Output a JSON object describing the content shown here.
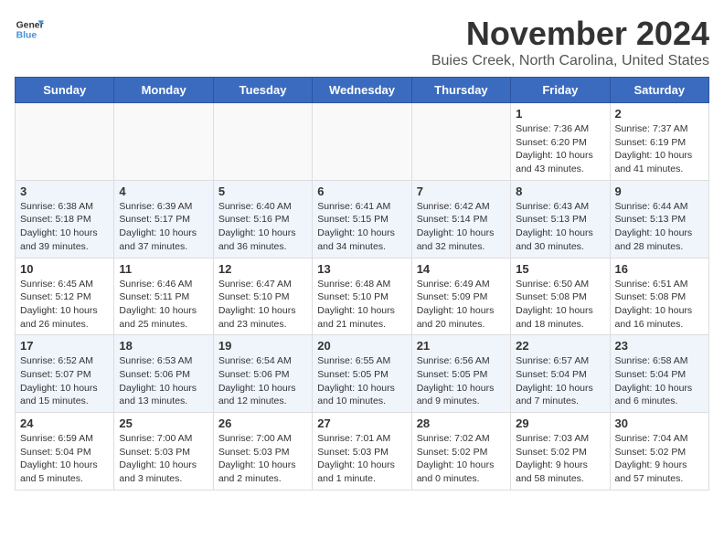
{
  "header": {
    "logo_general": "General",
    "logo_blue": "Blue",
    "month_title": "November 2024",
    "location": "Buies Creek, North Carolina, United States"
  },
  "weekdays": [
    "Sunday",
    "Monday",
    "Tuesday",
    "Wednesday",
    "Thursday",
    "Friday",
    "Saturday"
  ],
  "weeks": [
    [
      {
        "day": "",
        "info": ""
      },
      {
        "day": "",
        "info": ""
      },
      {
        "day": "",
        "info": ""
      },
      {
        "day": "",
        "info": ""
      },
      {
        "day": "",
        "info": ""
      },
      {
        "day": "1",
        "info": "Sunrise: 7:36 AM\nSunset: 6:20 PM\nDaylight: 10 hours and 43 minutes."
      },
      {
        "day": "2",
        "info": "Sunrise: 7:37 AM\nSunset: 6:19 PM\nDaylight: 10 hours and 41 minutes."
      }
    ],
    [
      {
        "day": "3",
        "info": "Sunrise: 6:38 AM\nSunset: 5:18 PM\nDaylight: 10 hours and 39 minutes."
      },
      {
        "day": "4",
        "info": "Sunrise: 6:39 AM\nSunset: 5:17 PM\nDaylight: 10 hours and 37 minutes."
      },
      {
        "day": "5",
        "info": "Sunrise: 6:40 AM\nSunset: 5:16 PM\nDaylight: 10 hours and 36 minutes."
      },
      {
        "day": "6",
        "info": "Sunrise: 6:41 AM\nSunset: 5:15 PM\nDaylight: 10 hours and 34 minutes."
      },
      {
        "day": "7",
        "info": "Sunrise: 6:42 AM\nSunset: 5:14 PM\nDaylight: 10 hours and 32 minutes."
      },
      {
        "day": "8",
        "info": "Sunrise: 6:43 AM\nSunset: 5:13 PM\nDaylight: 10 hours and 30 minutes."
      },
      {
        "day": "9",
        "info": "Sunrise: 6:44 AM\nSunset: 5:13 PM\nDaylight: 10 hours and 28 minutes."
      }
    ],
    [
      {
        "day": "10",
        "info": "Sunrise: 6:45 AM\nSunset: 5:12 PM\nDaylight: 10 hours and 26 minutes."
      },
      {
        "day": "11",
        "info": "Sunrise: 6:46 AM\nSunset: 5:11 PM\nDaylight: 10 hours and 25 minutes."
      },
      {
        "day": "12",
        "info": "Sunrise: 6:47 AM\nSunset: 5:10 PM\nDaylight: 10 hours and 23 minutes."
      },
      {
        "day": "13",
        "info": "Sunrise: 6:48 AM\nSunset: 5:10 PM\nDaylight: 10 hours and 21 minutes."
      },
      {
        "day": "14",
        "info": "Sunrise: 6:49 AM\nSunset: 5:09 PM\nDaylight: 10 hours and 20 minutes."
      },
      {
        "day": "15",
        "info": "Sunrise: 6:50 AM\nSunset: 5:08 PM\nDaylight: 10 hours and 18 minutes."
      },
      {
        "day": "16",
        "info": "Sunrise: 6:51 AM\nSunset: 5:08 PM\nDaylight: 10 hours and 16 minutes."
      }
    ],
    [
      {
        "day": "17",
        "info": "Sunrise: 6:52 AM\nSunset: 5:07 PM\nDaylight: 10 hours and 15 minutes."
      },
      {
        "day": "18",
        "info": "Sunrise: 6:53 AM\nSunset: 5:06 PM\nDaylight: 10 hours and 13 minutes."
      },
      {
        "day": "19",
        "info": "Sunrise: 6:54 AM\nSunset: 5:06 PM\nDaylight: 10 hours and 12 minutes."
      },
      {
        "day": "20",
        "info": "Sunrise: 6:55 AM\nSunset: 5:05 PM\nDaylight: 10 hours and 10 minutes."
      },
      {
        "day": "21",
        "info": "Sunrise: 6:56 AM\nSunset: 5:05 PM\nDaylight: 10 hours and 9 minutes."
      },
      {
        "day": "22",
        "info": "Sunrise: 6:57 AM\nSunset: 5:04 PM\nDaylight: 10 hours and 7 minutes."
      },
      {
        "day": "23",
        "info": "Sunrise: 6:58 AM\nSunset: 5:04 PM\nDaylight: 10 hours and 6 minutes."
      }
    ],
    [
      {
        "day": "24",
        "info": "Sunrise: 6:59 AM\nSunset: 5:04 PM\nDaylight: 10 hours and 5 minutes."
      },
      {
        "day": "25",
        "info": "Sunrise: 7:00 AM\nSunset: 5:03 PM\nDaylight: 10 hours and 3 minutes."
      },
      {
        "day": "26",
        "info": "Sunrise: 7:00 AM\nSunset: 5:03 PM\nDaylight: 10 hours and 2 minutes."
      },
      {
        "day": "27",
        "info": "Sunrise: 7:01 AM\nSunset: 5:03 PM\nDaylight: 10 hours and 1 minute."
      },
      {
        "day": "28",
        "info": "Sunrise: 7:02 AM\nSunset: 5:02 PM\nDaylight: 10 hours and 0 minutes."
      },
      {
        "day": "29",
        "info": "Sunrise: 7:03 AM\nSunset: 5:02 PM\nDaylight: 9 hours and 58 minutes."
      },
      {
        "day": "30",
        "info": "Sunrise: 7:04 AM\nSunset: 5:02 PM\nDaylight: 9 hours and 57 minutes."
      }
    ]
  ]
}
